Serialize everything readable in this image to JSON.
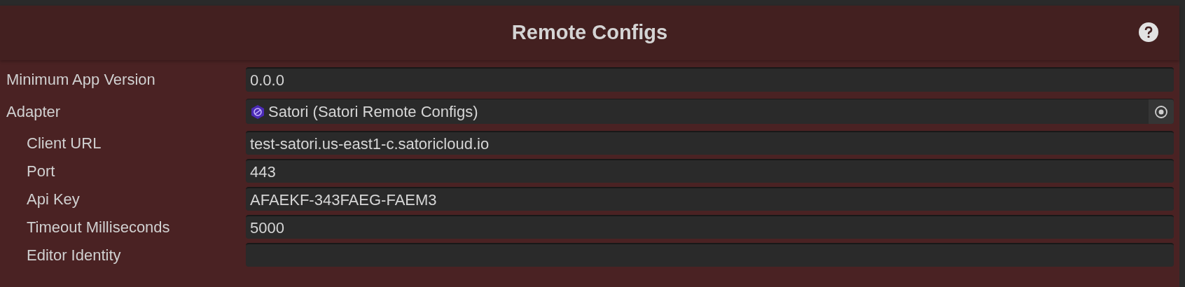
{
  "header": {
    "title": "Remote Configs"
  },
  "fields": [
    {
      "kind": "text",
      "label": "Minimum App Version",
      "value": "0.0.0"
    },
    {
      "kind": "object",
      "label": "Adapter",
      "value": "Satori (Satori Remote Configs)",
      "children": [
        {
          "kind": "text",
          "label": "Client URL",
          "value": "test-satori.us-east1-c.satoricloud.io"
        },
        {
          "kind": "text",
          "label": "Port",
          "value": "443"
        },
        {
          "kind": "text",
          "label": "Api Key",
          "value": "AFAEKF-343FAEG-FAEM3"
        },
        {
          "kind": "text",
          "label": "Timeout Milliseconds",
          "value": "5000"
        },
        {
          "kind": "text",
          "label": "Editor Identity"
        }
      ]
    }
  ]
}
